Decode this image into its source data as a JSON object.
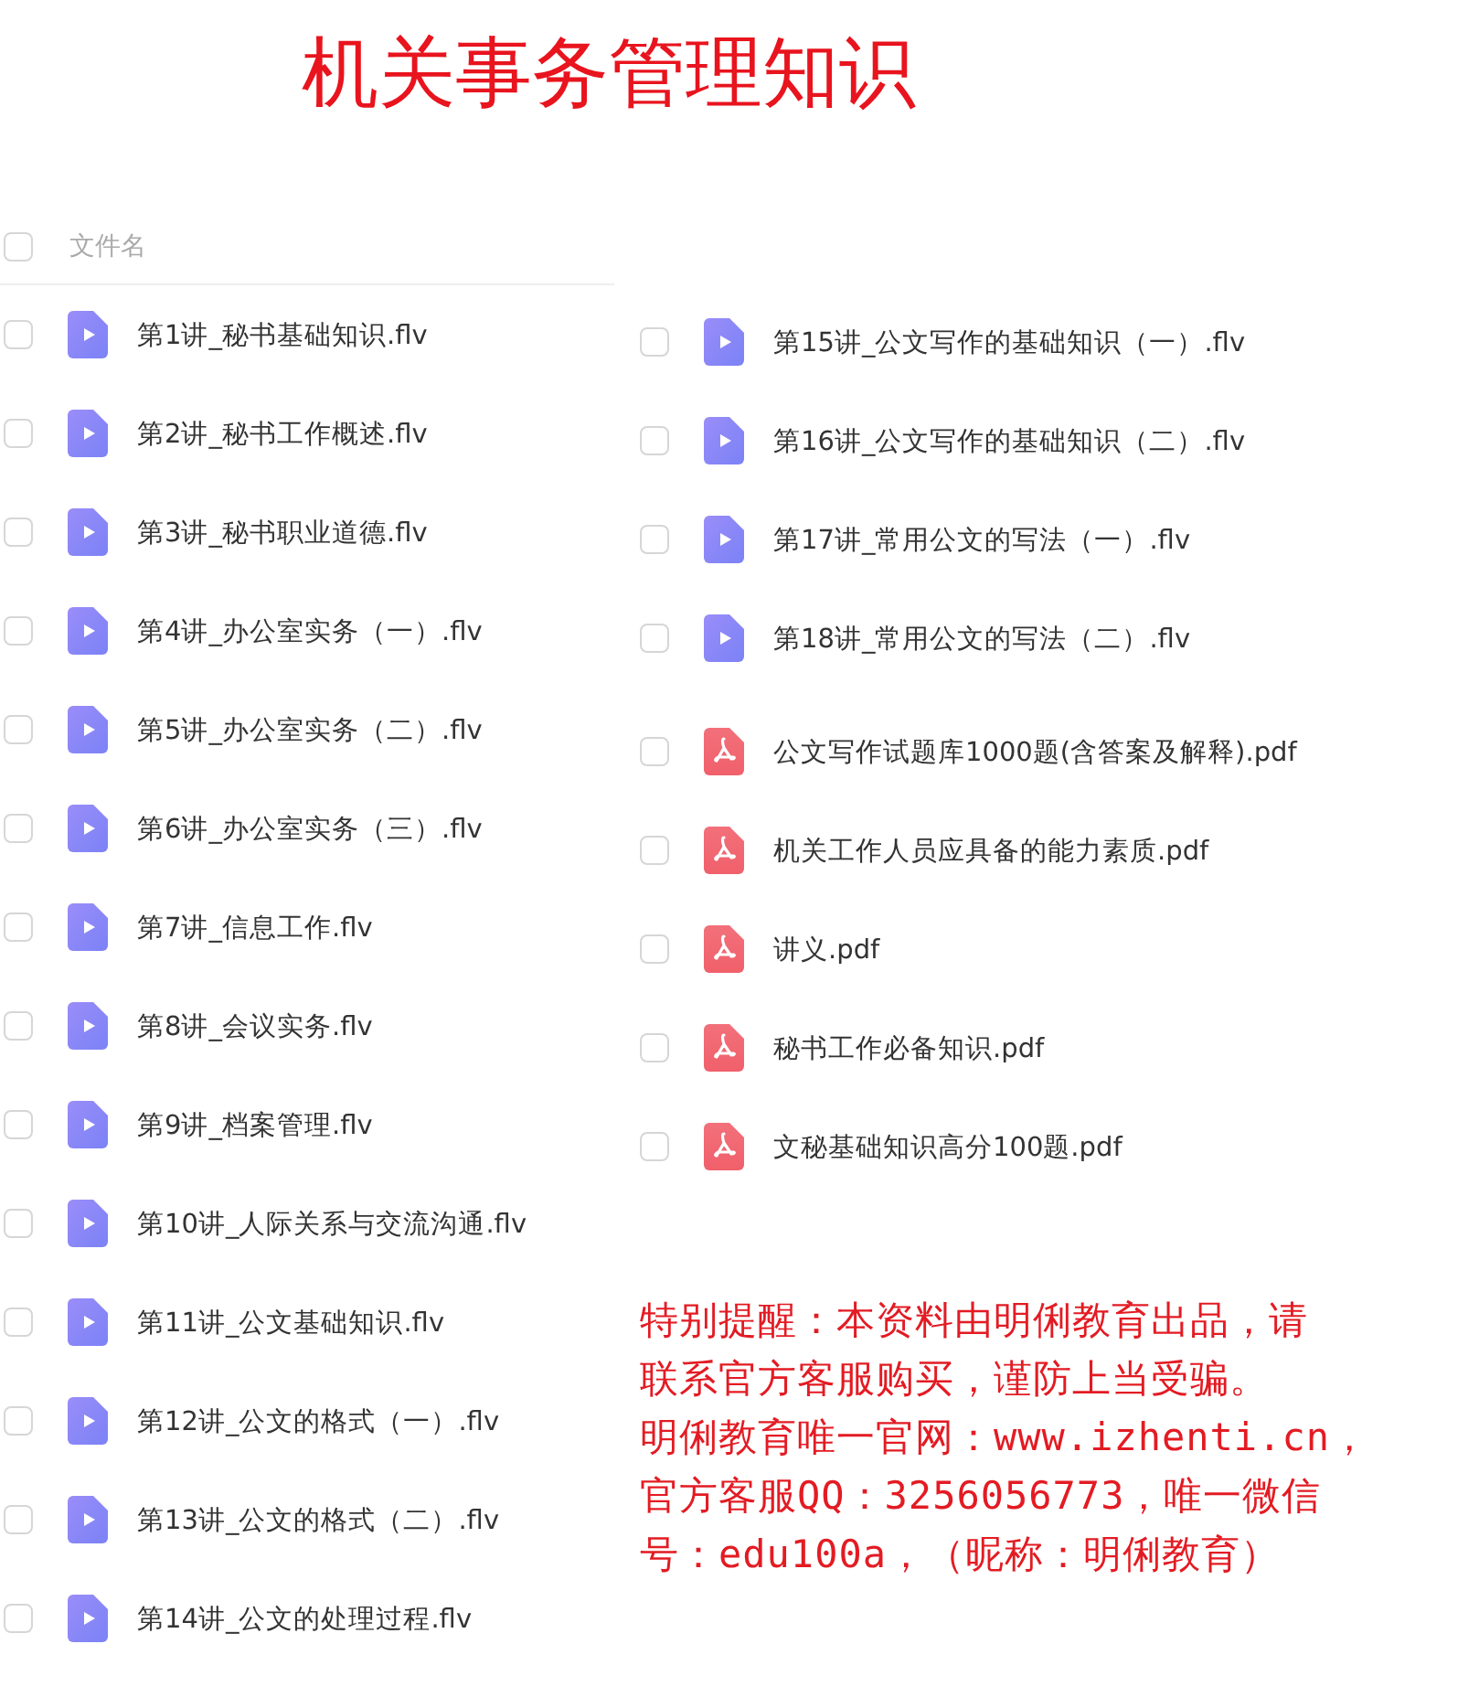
{
  "title": "机关事务管理知识",
  "header": {
    "label": "文件名",
    "checked": false
  },
  "left_files": [
    {
      "name": "第1讲_秘书基础知识.flv",
      "kind": "video",
      "checked": false
    },
    {
      "name": "第2讲_秘书工作概述.flv",
      "kind": "video",
      "checked": false
    },
    {
      "name": "第3讲_秘书职业道德.flv",
      "kind": "video",
      "checked": false
    },
    {
      "name": "第4讲_办公室实务（一）.flv",
      "kind": "video",
      "checked": false
    },
    {
      "name": "第5讲_办公室实务（二）.flv",
      "kind": "video",
      "checked": false
    },
    {
      "name": "第6讲_办公室实务（三）.flv",
      "kind": "video",
      "checked": false
    },
    {
      "name": "第7讲_信息工作.flv",
      "kind": "video",
      "checked": false
    },
    {
      "name": "第8讲_会议实务.flv",
      "kind": "video",
      "checked": false
    },
    {
      "name": "第9讲_档案管理.flv",
      "kind": "video",
      "checked": false
    },
    {
      "name": "第10讲_人际关系与交流沟通.flv",
      "kind": "video",
      "checked": false
    },
    {
      "name": "第11讲_公文基础知识.flv",
      "kind": "video",
      "checked": false
    },
    {
      "name": "第12讲_公文的格式（一）.flv",
      "kind": "video",
      "checked": false
    },
    {
      "name": "第13讲_公文的格式（二）.flv",
      "kind": "video",
      "checked": false
    },
    {
      "name": "第14讲_公文的处理过程.flv",
      "kind": "video",
      "checked": false
    }
  ],
  "right_files": [
    {
      "name": "第15讲_公文写作的基础知识（一）.flv",
      "kind": "video",
      "checked": false
    },
    {
      "name": "第16讲_公文写作的基础知识（二）.flv",
      "kind": "video",
      "checked": false
    },
    {
      "name": "第17讲_常用公文的写法（一）.flv",
      "kind": "video",
      "checked": false
    },
    {
      "name": "第18讲_常用公文的写法（二）.flv",
      "kind": "video",
      "checked": false
    },
    {
      "name": "公文写作试题库1000题(含答案及解释).pdf",
      "kind": "pdf",
      "checked": false
    },
    {
      "name": "机关工作人员应具备的能力素质.pdf",
      "kind": "pdf",
      "checked": false
    },
    {
      "name": "讲义.pdf",
      "kind": "pdf",
      "checked": false
    },
    {
      "name": "秘书工作必备知识.pdf",
      "kind": "pdf",
      "checked": false
    },
    {
      "name": "文秘基础知识高分100题.pdf",
      "kind": "pdf",
      "checked": false
    }
  ],
  "notice_lines": [
    "特别提醒：本资料由明俐教育出品，请",
    "联系官方客服购买，谨防上当受骗。",
    "明俐教育唯一官网：www.izhenti.cn，",
    "官方客服QQ：3256056773，唯一微信",
    "号：edu100a，（昵称：明俐教育）"
  ]
}
